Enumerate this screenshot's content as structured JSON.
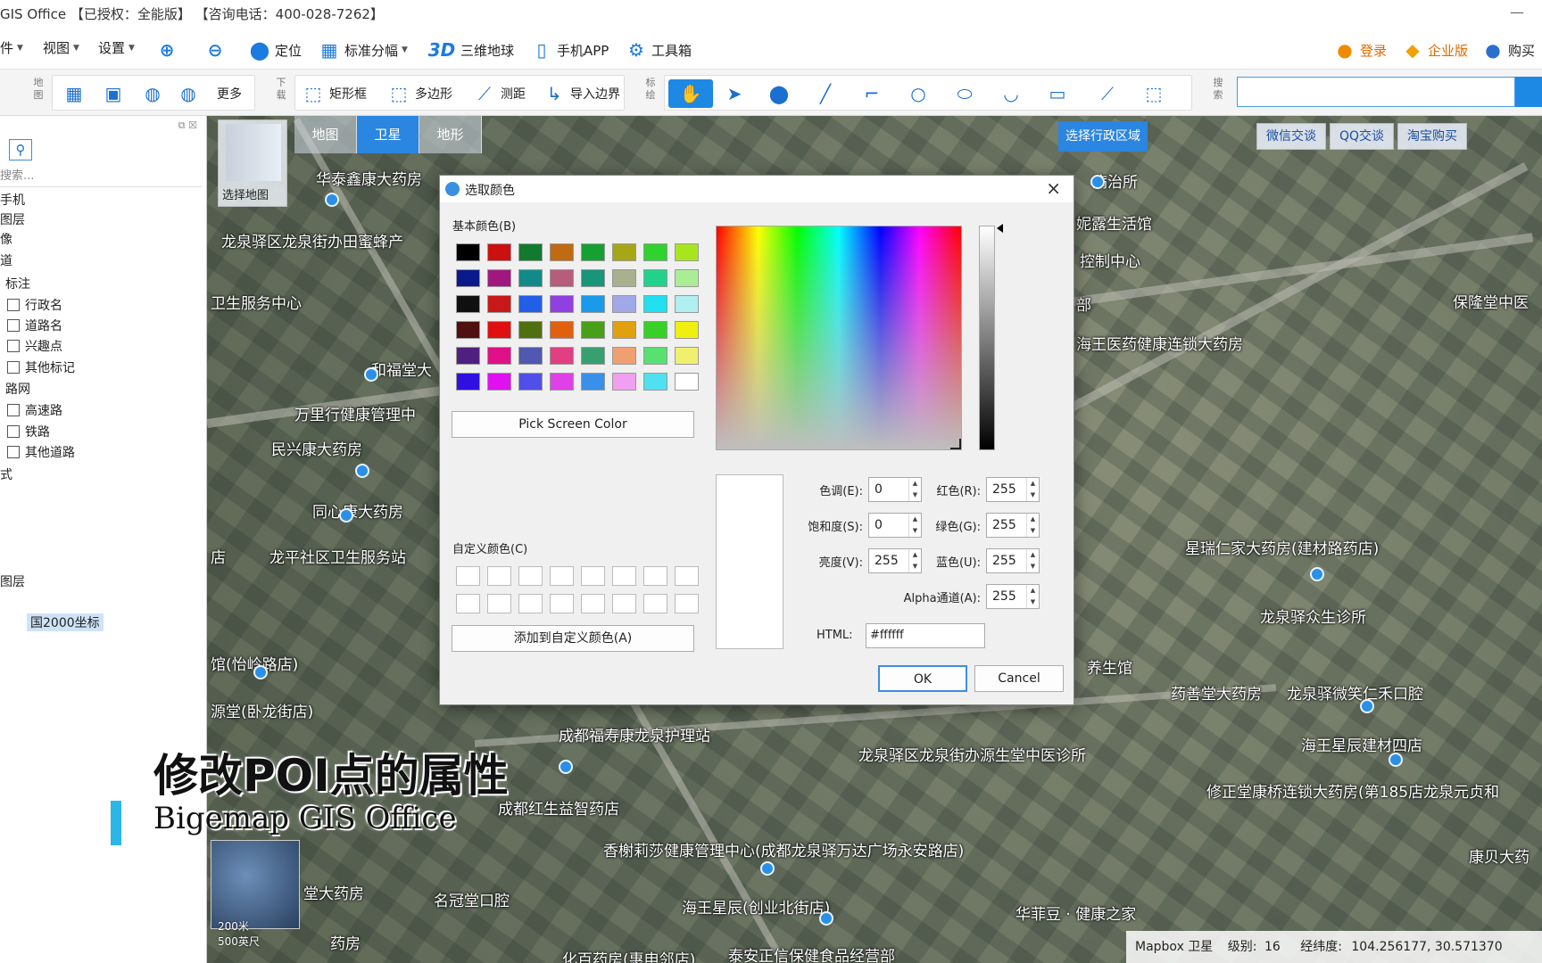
{
  "window": {
    "title": "GIS Office 【已授权：全能版】 【咨询电话：400-028-7262】",
    "controls": "—"
  },
  "menu": {
    "file": "件",
    "view": "视图",
    "settings": "设置",
    "locate": "定位",
    "std_sheet": "标准分幅",
    "three_d_icon": "3D",
    "globe_3d": "三维地球",
    "mobile_app": "手机APP",
    "toolbox": "工具箱",
    "login": "登录",
    "enterprise": "企业版",
    "buy": "购买"
  },
  "toolbar": {
    "map_label": "地图",
    "more": "更多",
    "download_label": "下载",
    "rect": "矩形框",
    "polygon": "多边形",
    "measure": "测距",
    "import_boundary": "导入边界",
    "annot_label": "标绘",
    "search_label": "搜索"
  },
  "left_panel": {
    "search_placeholder": "搜索...",
    "items": [
      "手机",
      "图层",
      "像",
      "道"
    ],
    "annotation": "标注",
    "annotation_children": [
      "行政名",
      "道路名",
      "兴趣点",
      "其他标记"
    ],
    "roadnet": "路网",
    "roadnet_children": [
      "高速路",
      "铁路",
      "其他道路"
    ],
    "style": "式",
    "layer": "图层",
    "coord": "国2000坐标"
  },
  "map": {
    "tabs": [
      "地图",
      "卫星",
      "地形"
    ],
    "active_tab": "卫星",
    "chooser_label": "选择地图",
    "region_button": "选择行政区域",
    "contact": [
      "微信交谈",
      "QQ交谈",
      "淘宝购买"
    ],
    "labels": [
      "华泰鑫康大药房",
      "龙泉驿区龙泉街办田蜜蜂产",
      "卫生服务中心",
      "和福堂大",
      "万里行健康管理中",
      "民兴康大药房",
      "同心康大药房",
      "龙平社区卫生服务站",
      "店",
      "馆(怡岭路店)",
      "源堂(卧龙街店)",
      "成都福寿康龙泉护理站",
      "成都红生益智药店",
      "香榭莉莎健康管理中心(成都龙泉驿万达广场永安路店)",
      "名冠堂口腔",
      "海王星辰(创业北街店)",
      "华菲豆 · 健康之家",
      "堂大药房",
      "药房",
      "泰安正信保健食品经营部",
      "化百药房(惠申邻店)",
      "龙泉驿区龙泉街办源生堂中医诊所",
      "养生馆",
      "药善堂大药房",
      "龙泉驿微笑仁禾口腔",
      "海王星辰建材四店",
      "修正堂康桥连锁大药房(第185店龙泉元贞和",
      "康贝大药",
      "龙泉驿众生诊所",
      "星瑞仁家大药房(建材路药店)",
      "海王医药健康连锁大药房",
      "保隆堂中医",
      "病治所",
      "妮露生活馆",
      "控制中心",
      "部"
    ]
  },
  "dialog": {
    "title": "选取颜色",
    "close": "×",
    "basic_colors_label": "基本颜色(B)",
    "basic_colors": [
      "#000000",
      "#cc0f0f",
      "#127a2e",
      "#c06b12",
      "#16a032",
      "#a6a616",
      "#2fd22f",
      "#a7e61f",
      "#0a1a8c",
      "#a0187e",
      "#138a8a",
      "#b85c7c",
      "#18957a",
      "#a8b08e",
      "#22d28a",
      "#a9ee96",
      "#101010",
      "#c81818",
      "#2060e8",
      "#9040e0",
      "#1a9ae8",
      "#a0a8e8",
      "#20e0f0",
      "#b0f0f0",
      "#501010",
      "#e01010",
      "#507010",
      "#e06010",
      "#48a018",
      "#e0a010",
      "#38d028",
      "#f0f010",
      "#502080",
      "#e01088",
      "#5058b0",
      "#e04080",
      "#38a070",
      "#f0a070",
      "#58e070",
      "#f0f070",
      "#3010e0",
      "#e010f0",
      "#5050e8",
      "#e040e8",
      "#3890e8",
      "#f0a0f0",
      "#50e0f0",
      "#ffffff"
    ],
    "pick_screen": "Pick Screen Color",
    "custom_colors_label": "自定义颜色(C)",
    "add_custom": "添加到自定义颜色(A)",
    "hue_label": "色调(E):",
    "hue": "0",
    "sat_label": "饱和度(S):",
    "sat": "0",
    "val_label": "亮度(V):",
    "val": "255",
    "red_label": "红色(R):",
    "red": "255",
    "green_label": "绿色(G):",
    "green": "255",
    "blue_label": "蓝色(U):",
    "blue": "255",
    "alpha_label": "Alpha通道(A):",
    "alpha": "255",
    "html_label": "HTML:",
    "html": "#ffffff",
    "ok": "OK",
    "cancel": "Cancel"
  },
  "caption": {
    "title": "修改POI点的属性",
    "subtitle": "Bigemap GIS Office"
  },
  "status": {
    "source": "Mapbox 卫星",
    "level_label": "级别:",
    "level": "16",
    "coord_label": "经纬度:",
    "coord": "104.256177, 30.571370"
  },
  "scale": {
    "a": "200米",
    "b": "500英尺"
  }
}
